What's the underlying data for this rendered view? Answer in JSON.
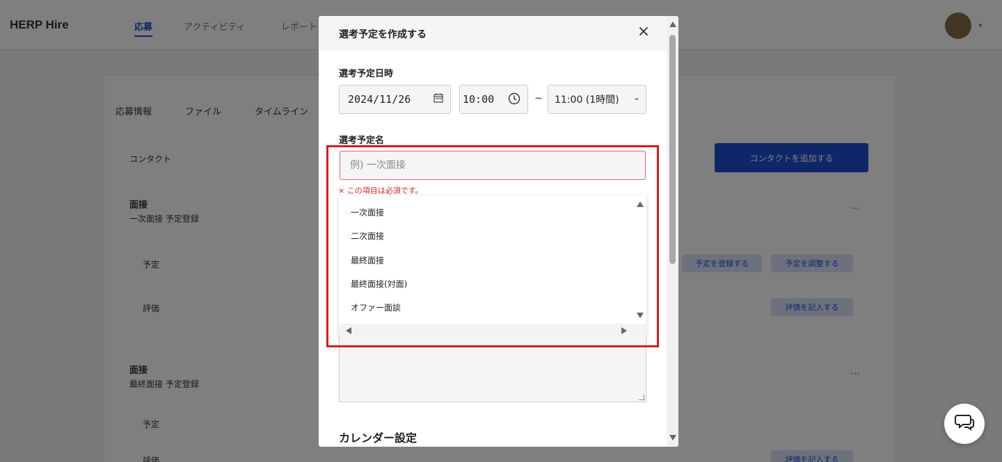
{
  "background": {
    "logo": "HERP Hire",
    "nav": [
      "応募",
      "アクティビティ",
      "レポート"
    ],
    "tabs": [
      "応募情報",
      "ファイル",
      "タイムライン"
    ],
    "contact_label": "コンタクト",
    "section1_title": "面接",
    "section1_sub": "一次面接 予定登録",
    "section2_title": "面接",
    "section2_sub": "最終面接 予定登録",
    "row_labels": [
      "予定",
      "評価",
      "予定",
      "評価"
    ],
    "primary_button": "コンタクトを追加する",
    "pill_buttons": [
      "予定を登録する",
      "予定を調整する",
      "評価を記入する",
      "評価を記入する"
    ]
  },
  "modal": {
    "title": "選考予定を作成する",
    "close": "×",
    "datetime_label": "選考予定日時",
    "date_value": "2024/11/26",
    "start_time": "10:00",
    "tilde": "~",
    "end_time": "11:00 (1時間)",
    "name_label": "選考予定名",
    "name_placeholder": "例) 一次面接",
    "error": "× この項目は必須です。",
    "options": [
      "一次面接",
      "二次面接",
      "最終面接",
      "最終面接(対面)",
      "オファー面談"
    ],
    "calendar_label": "カレンダー設定"
  },
  "colors": {
    "accent": "#1f4fd1",
    "error": "#d62424",
    "highlight": "#e01818"
  },
  "icons": {
    "calendar": "calendar-icon",
    "clock": "clock-icon",
    "chat": "chat-icon"
  }
}
